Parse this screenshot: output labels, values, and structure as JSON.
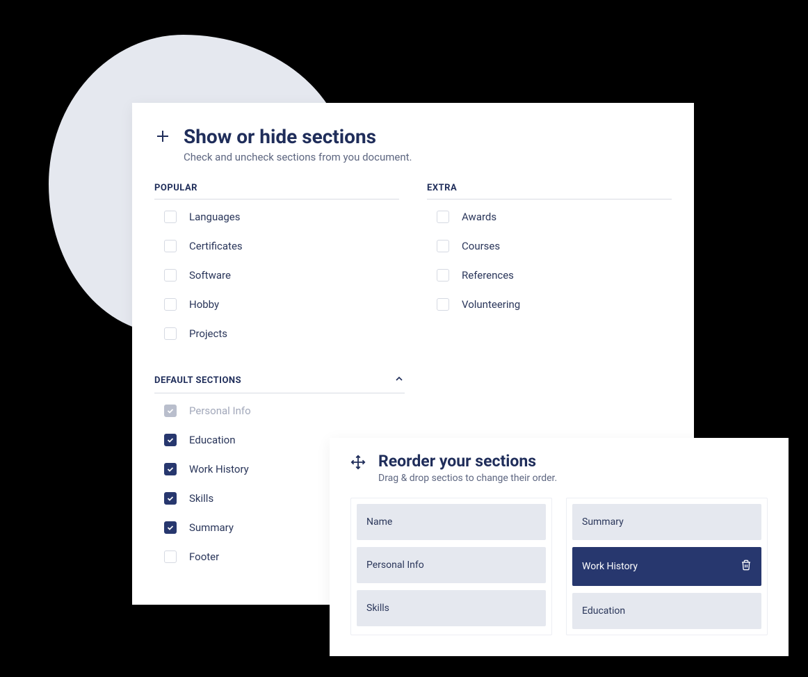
{
  "sections_panel": {
    "title": "Show or hide sections",
    "subtitle": "Check and uncheck sections from you document.",
    "popular_label": "POPULAR",
    "extra_label": "EXTRA",
    "default_label": "DEFAULT SECTIONS",
    "popular": [
      {
        "label": "Languages",
        "checked": false
      },
      {
        "label": "Certificates",
        "checked": false
      },
      {
        "label": "Software",
        "checked": false
      },
      {
        "label": "Hobby",
        "checked": false
      },
      {
        "label": "Projects",
        "checked": false
      }
    ],
    "extra": [
      {
        "label": "Awards",
        "checked": false
      },
      {
        "label": "Courses",
        "checked": false
      },
      {
        "label": "References",
        "checked": false
      },
      {
        "label": "Volunteering",
        "checked": false
      }
    ],
    "defaults": [
      {
        "label": "Personal Info",
        "checked": true,
        "disabled": true
      },
      {
        "label": "Education",
        "checked": true,
        "disabled": false
      },
      {
        "label": "Work History",
        "checked": true,
        "disabled": false
      },
      {
        "label": "Skills",
        "checked": true,
        "disabled": false
      },
      {
        "label": "Summary",
        "checked": true,
        "disabled": false
      },
      {
        "label": "Footer",
        "checked": false,
        "disabled": false
      }
    ]
  },
  "reorder_panel": {
    "title": "Reorder your sections",
    "subtitle": "Drag & drop sectios to change their order.",
    "left": [
      {
        "label": "Name",
        "active": false
      },
      {
        "label": "Personal Info",
        "active": false
      },
      {
        "label": "Skills",
        "active": false
      }
    ],
    "right": [
      {
        "label": "Summary",
        "active": false
      },
      {
        "label": "Work History",
        "active": true
      },
      {
        "label": "Education",
        "active": false
      }
    ]
  }
}
